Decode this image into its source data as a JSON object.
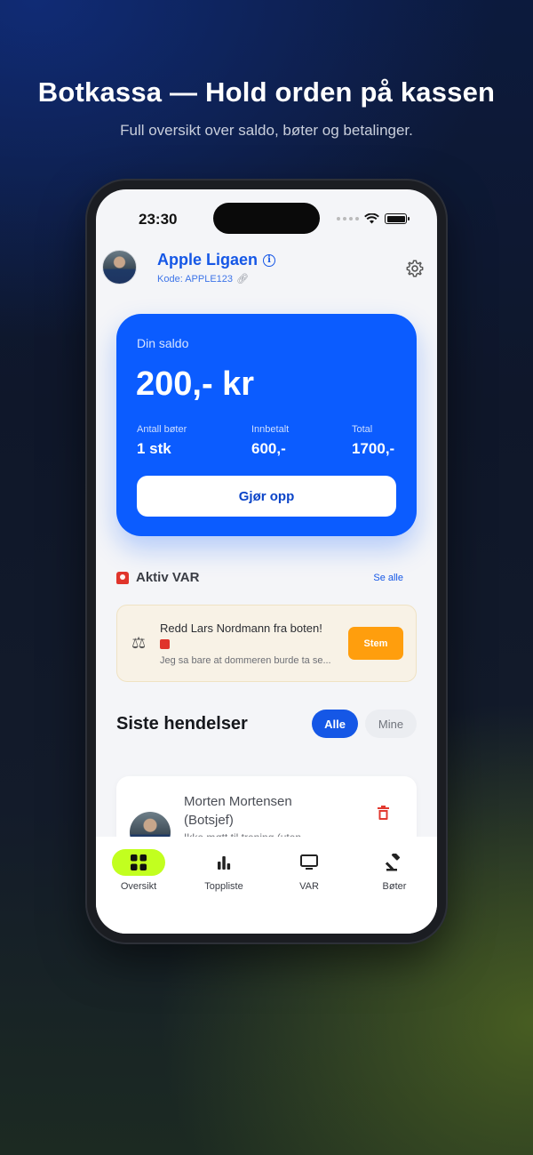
{
  "promo": {
    "title": "Botkassa — Hold orden på kassen",
    "subtitle": "Full oversikt over saldo, bøter og betalinger."
  },
  "status_bar": {
    "time": "23:30"
  },
  "header": {
    "team_name": "Apple Ligaen",
    "team_code": "Kode: APPLE123",
    "icons": [
      "info-icon",
      "link-icon",
      "gear-icon"
    ]
  },
  "balance": {
    "label": "Din saldo",
    "amount": "200,- kr",
    "stats": [
      {
        "label": "Antall bøter",
        "value": "1 stk"
      },
      {
        "label": "Innbetalt",
        "value": "600,-"
      },
      {
        "label": "Total",
        "value": "1700,-"
      }
    ],
    "button_label": "Gjør opp",
    "color": "#0b5cff"
  },
  "var_section": {
    "title": "Aktiv VAR",
    "see_all": "Se alle",
    "card": {
      "title": "Redd Lars Nordmann fra boten!",
      "description": "Jeg sa bare at dommeren burde ta se...",
      "vote_label": "Stem"
    }
  },
  "events": {
    "title": "Siste hendelser",
    "filters": {
      "all": "Alle",
      "mine": "Mine"
    },
    "items": [
      {
        "name": "Morten Mortensen (Botsjef)",
        "description": "Ikke møtt til trening (uten"
      }
    ]
  },
  "tabbar": {
    "items": [
      {
        "label": "Oversikt",
        "icon": "grid-icon",
        "active": true
      },
      {
        "label": "Toppliste",
        "icon": "bar-chart-icon",
        "active": false
      },
      {
        "label": "VAR",
        "icon": "monitor-icon",
        "active": false
      },
      {
        "label": "Bøter",
        "icon": "gavel-icon",
        "active": false
      }
    ],
    "active_color": "#c2ff1f"
  }
}
